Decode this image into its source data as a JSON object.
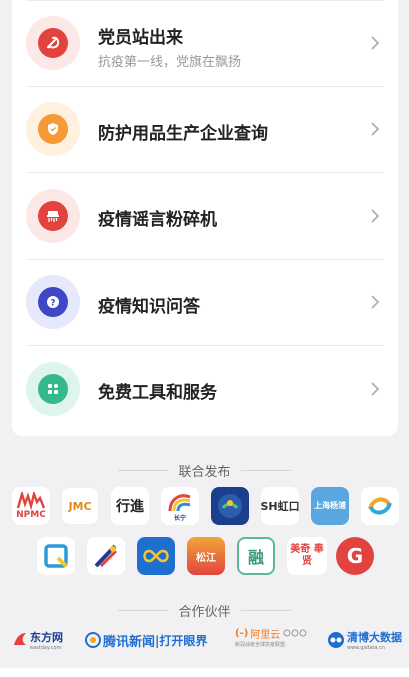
{
  "menu": {
    "items": [
      {
        "title": "党员站出来",
        "subtitle": "抗疫第一线，党旗在飘扬",
        "icon": "party-emblem-icon",
        "halo": "#fde8e8",
        "core": "#e2433f"
      },
      {
        "title": "防护用品生产企业查询",
        "subtitle": "",
        "icon": "shield-icon",
        "halo": "#fff0e0",
        "core": "#f59a34"
      },
      {
        "title": "疫情谣言粉碎机",
        "subtitle": "",
        "icon": "shredder-icon",
        "halo": "#fde8e8",
        "core": "#e2433f"
      },
      {
        "title": "疫情知识问答",
        "subtitle": "",
        "icon": "question-icon",
        "halo": "#e6e8fb",
        "core": "#3d47c8"
      },
      {
        "title": "免费工具和服务",
        "subtitle": "",
        "icon": "toolbox-icon",
        "halo": "#dff5ec",
        "core": "#35b98a"
      }
    ]
  },
  "joint_release": {
    "heading": "联合发布",
    "logos_row1": [
      {
        "name": "npmc-logo",
        "text": "NPMC"
      },
      {
        "name": "jmc-logo",
        "text": "JMC"
      },
      {
        "name": "calligraphy-logo",
        "text": "行進"
      },
      {
        "name": "rainbow-logo",
        "text": "长宁"
      },
      {
        "name": "emblem-logo",
        "text": ""
      },
      {
        "name": "sh-hongkou-logo",
        "text": "SH虹口"
      },
      {
        "name": "yangpu-logo",
        "text": "上海杨浦"
      },
      {
        "name": "swirl-logo",
        "text": ""
      }
    ],
    "logos_row2": [
      {
        "name": "square-q-logo",
        "text": ""
      },
      {
        "name": "rocket-logo",
        "text": ""
      },
      {
        "name": "cloud-link-logo",
        "text": ""
      },
      {
        "name": "songjiang-logo",
        "text": "松江"
      },
      {
        "name": "rong-logo",
        "text": "融"
      },
      {
        "name": "fengxian-logo",
        "text": "美奇 奉贤"
      },
      {
        "name": "g-circle-logo",
        "text": "G"
      }
    ]
  },
  "partners": {
    "heading": "合作伙伴",
    "items": [
      {
        "name": "eastday-logo",
        "text": "东方网",
        "sub": "eastday.com"
      },
      {
        "name": "tencent-news-logo",
        "text": "腾讯新闻",
        "extra": "|打开眼界"
      },
      {
        "name": "aliyun-logo",
        "text": "阿里云",
        "sub": "新冠战疫全球抗疫联盟"
      },
      {
        "name": "qingbo-logo",
        "text": "清博大数据",
        "sub": "www.gsdata.cn"
      }
    ]
  },
  "colors": {
    "red": "#e2433f",
    "blue": "#1a3d96",
    "green": "#35b98a",
    "orange": "#f59a34"
  }
}
